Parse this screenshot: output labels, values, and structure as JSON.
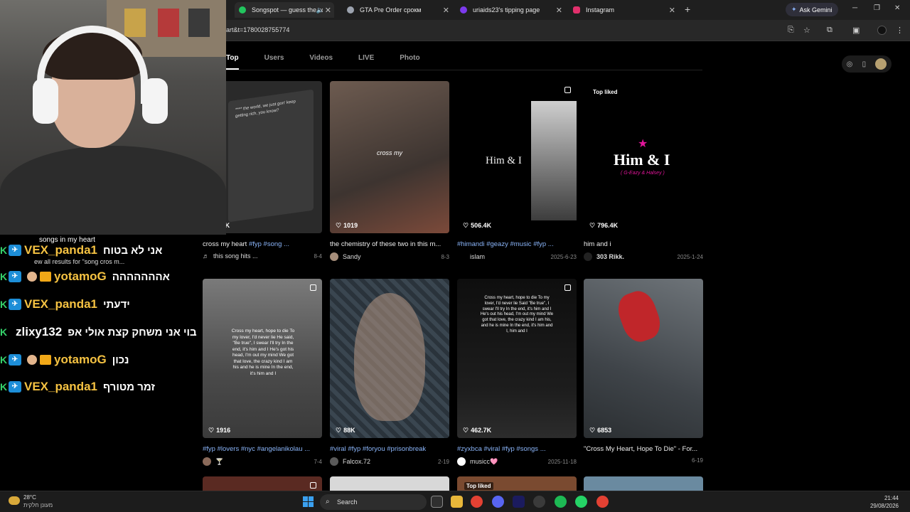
{
  "browser": {
    "tabs": [
      {
        "title": "Songspot — guess the song",
        "favicon_color": "#22c55e",
        "active": true
      },
      {
        "title": "GTA Pre Order срокм",
        "favicon_color": "#9ca3af"
      },
      {
        "title": "uriaids23's tipping page",
        "favicon_color": "#7c3aed"
      },
      {
        "title": "Instagram",
        "favicon_color": "#e1306c"
      }
    ],
    "ask_gemini": "Ask Gemini",
    "url": "art&t=1780028755774"
  },
  "search_tabs": [
    "Top",
    "Users",
    "Videos",
    "LIVE",
    "Photo"
  ],
  "results_row1": [
    {
      "likes": "2.7K",
      "caption_text": "cross my heart ",
      "caption_tags": "#fyp #song ...",
      "author": "this song hits ...",
      "date": "8-4",
      "overlay": "**** the world, we just gon' keep getting rich, you know?",
      "bg": "#2a2a2a"
    },
    {
      "likes": "1019",
      "caption_text": "the chemistry of these two in this m...",
      "caption_tags": "",
      "author": "Sandy",
      "date": "8-3",
      "overlay": "cross my",
      "bg": "#5a4c44"
    },
    {
      "likes": "506.4K",
      "caption_text": "",
      "caption_tags": "#himandi #geazy #music #fyp ...",
      "author": "islam",
      "date": "2025-6-23",
      "overlay": "Him & I",
      "bg": "#000000"
    },
    {
      "likes": "796.4K",
      "caption_text": "him and i",
      "caption_tags": "",
      "author": "303 Rikk.",
      "date": "2025-1-24",
      "overlay": "Him & I",
      "overlay_sub": "( G-Eazy & Halsey )",
      "badge": "Top liked",
      "bg": "#000000"
    }
  ],
  "results_row2": [
    {
      "likes": "1916",
      "caption_text": "",
      "caption_tags": "#fyp #lovers #nyc #angelanikolau ...",
      "author": "",
      "date": "7-4",
      "overlay": "Cross my heart, hope to die To my lover, I'd never lie He said, \"Be true\", I swear I'll try In the end, it's him and I He's got his head, I'm out my mind We got that love, the crazy kind I am his and he is mine In the end, it's him and I",
      "bg": "#5b5b5b"
    },
    {
      "likes": "88K",
      "caption_text": "",
      "caption_tags": "#viral #fyp #foryou #prisonbreak",
      "author": "Falcox.72",
      "date": "2-19",
      "overlay": "",
      "bg": "#34404a"
    },
    {
      "likes": "462.7K",
      "caption_text": "",
      "caption_tags": "#zyxbca #viral #fyp #songs ...",
      "author": "musicc🩷",
      "date": "2025-11-18",
      "overlay": "Cross my heart, hope to die To my lover, I'd never lie Said \"Be true\", I swear I'll try In the end, it's him and I He's out his head, I'm out my mind We got that love, the crazy kind I am his, and he is mine In the end, it's him and I, him and I",
      "bg": "#0c0c0c"
    },
    {
      "likes": "6853",
      "caption_text": "\"Cross My Heart, Hope To Die\" - For...",
      "caption_tags": "",
      "author": "",
      "date": "6-19",
      "overlay": "",
      "bg": "#4a4f55"
    }
  ],
  "results_row3": [
    {
      "badge": ""
    },
    {
      "badge": ""
    },
    {
      "badge": "Top liked"
    },
    {
      "badge": ""
    }
  ],
  "chat": {
    "header": "songs in my heart",
    "search_hint": "ew all results for \"song cros m...",
    "messages": [
      {
        "user": "VEX_panda1",
        "user_color": "#f5c242",
        "msg": "אני לא בטוח",
        "badges": [
          "twitch"
        ]
      },
      {
        "user": "yotamoG",
        "user_color": "#f5c242",
        "msg": "אההההההה",
        "badges": [
          "twitch",
          "face",
          "crown"
        ]
      },
      {
        "user": "VEX_panda1",
        "user_color": "#f5c242",
        "msg": "ידעתי",
        "badges": [
          "twitch"
        ]
      },
      {
        "user": "zlixy132",
        "user_color": "#ffffff",
        "msg": "בוי אני משחק קצת אולי אפ",
        "badges": []
      },
      {
        "user": "yotamoG",
        "user_color": "#f5c242",
        "msg": "נכון",
        "badges": [
          "twitch",
          "face",
          "crown"
        ]
      },
      {
        "user": "VEX_panda1",
        "user_color": "#f5c242",
        "msg": "זמר מטורף",
        "badges": [
          "twitch"
        ]
      }
    ]
  },
  "taskbar": {
    "temp": "28°C",
    "weather": "מעונן חלקית",
    "search": "Search",
    "time": "21:44",
    "date": "29/08/2026"
  }
}
